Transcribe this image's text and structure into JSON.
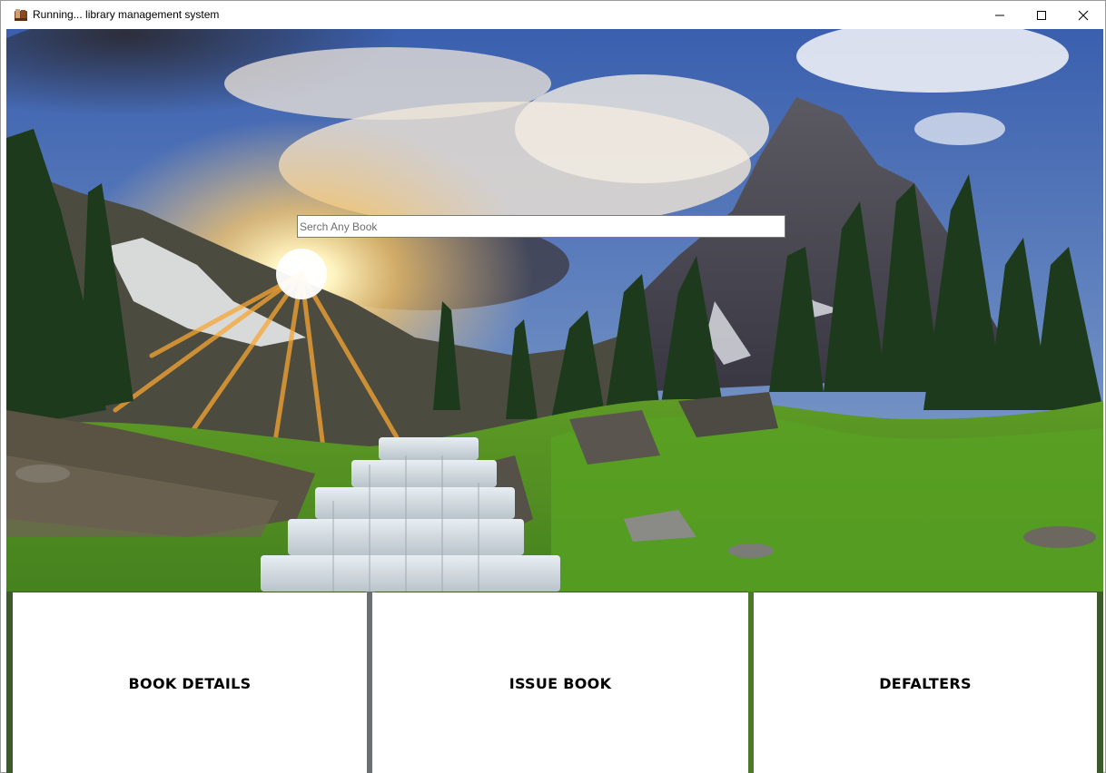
{
  "window": {
    "title": "Running... library management system",
    "icon": "books-icon",
    "controls": {
      "minimize": "minimize-icon",
      "maximize": "maximize-icon",
      "close": "close-icon"
    }
  },
  "search": {
    "value": "",
    "placeholder": "Serch Any Book"
  },
  "panels": [
    {
      "label": "BOOK DETAILS"
    },
    {
      "label": "ISSUE BOOK"
    },
    {
      "label": "DEFALTERS"
    }
  ],
  "background": {
    "description_colors": {
      "sky": "#3b6fc0",
      "grass": "#3f8f1f",
      "cloud": "#e8e2d8",
      "sun": "#fff3b0"
    }
  }
}
